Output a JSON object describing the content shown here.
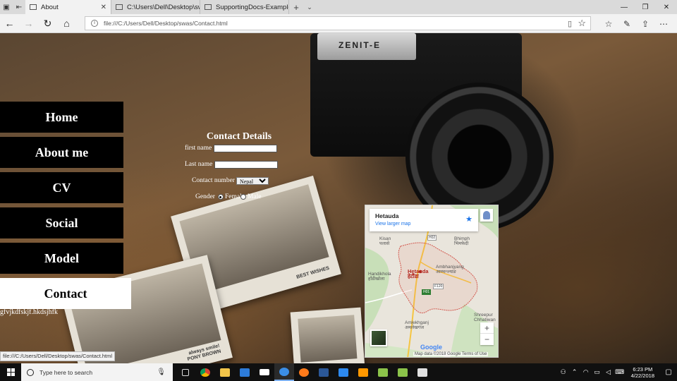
{
  "browser": {
    "tabs": [
      {
        "title": "About",
        "active": true
      },
      {
        "title": "C:\\Users\\Dell\\Desktop\\swas",
        "active": false
      },
      {
        "title": "SupportingDocs-Example-1",
        "active": false
      }
    ],
    "address": "file:///C:/Users/Dell/Desktop/swas/Contact.html",
    "status_url": "file:///C:/Users/Dell/Desktop/swas/Contact.html"
  },
  "sidebar": {
    "items": [
      {
        "label": "Home"
      },
      {
        "label": "About me"
      },
      {
        "label": "CV"
      },
      {
        "label": "Social"
      },
      {
        "label": "Model"
      },
      {
        "label": "Contact"
      }
    ],
    "active_item": "Contact",
    "footer_text": "gfvjkdfskjf.hkdsjhfk"
  },
  "contact_form": {
    "title": "Contact Details",
    "first_name_label": "first name",
    "first_name_value": "",
    "last_name_label": "Last name",
    "last_name_value": "",
    "contact_number_label": "Contact number",
    "country_selected": "Nepal",
    "gender_label": "Gender",
    "gender_options": [
      "Female",
      "Male"
    ],
    "gender_selected": "Female"
  },
  "map": {
    "place": "Hetauda",
    "larger_map_link": "View larger map",
    "labels": {
      "palase": "Kisan\nपलासे",
      "bhimphedi": "Bhimph\nभिमफेदी",
      "handikhola": "Handikhola\nहाँडीखोला",
      "city": "Hetauda\nहेटौंडा",
      "ambhanjyang": "Ambhanjyang\nआम्भन्ज्याङ",
      "amlekhganj": "Amlekhganj\nअमलेखगंज",
      "shreepur": "Shreepur\nChhatiwan"
    },
    "road_badges": [
      "H02",
      "F120",
      "H01"
    ],
    "zoom_in": "+",
    "zoom_out": "−",
    "logo": "Google",
    "footer": "Map data ©2018 Google   Terms of Use"
  },
  "background": {
    "camera_brand": "ZENIT-E",
    "photo_captions": [
      "always smile!\nPONY BROWN",
      "always smile!\nPONY BROWN"
    ],
    "postcard_text": "BEST WISHES"
  },
  "taskbar": {
    "search_placeholder": "Type here to search",
    "time": "6:23 PM",
    "date": "4/22/2018"
  },
  "icons": {
    "start": "windows-logo-icon",
    "search": "search-circle-icon"
  }
}
